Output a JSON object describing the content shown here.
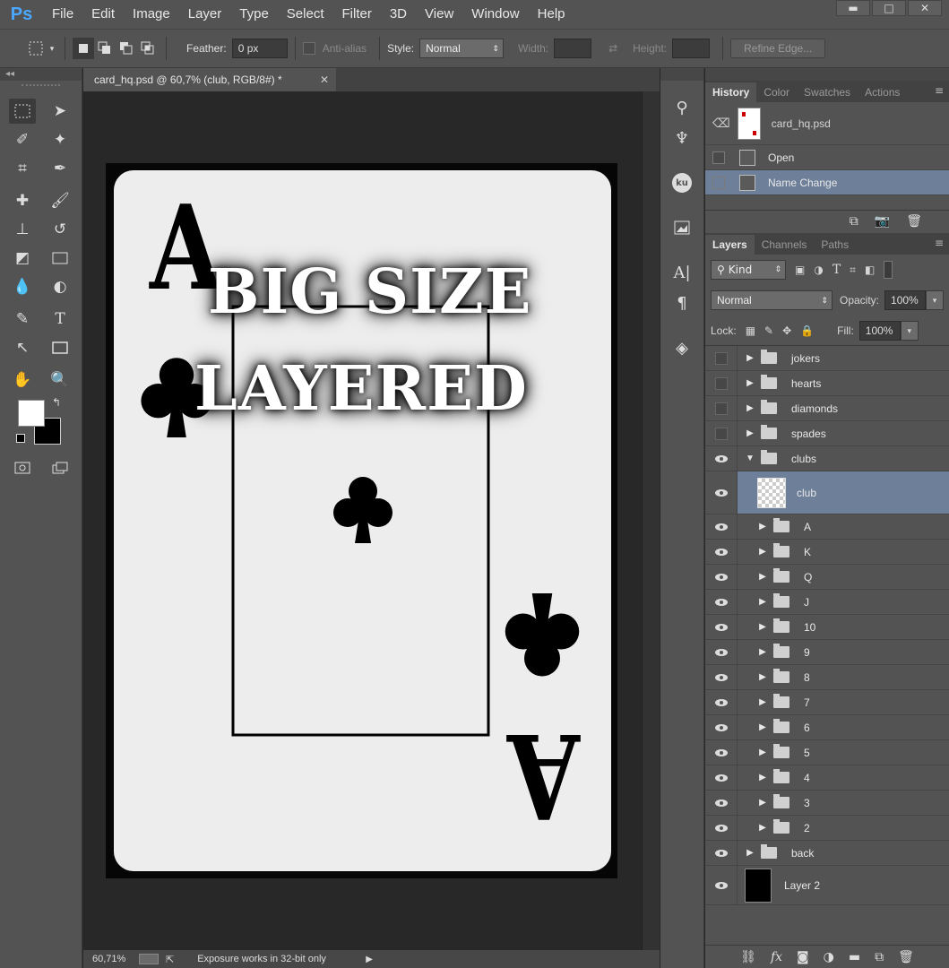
{
  "menubar": {
    "logo": "Ps",
    "items": [
      "File",
      "Edit",
      "Image",
      "Layer",
      "Type",
      "Select",
      "Filter",
      "3D",
      "View",
      "Window",
      "Help"
    ],
    "win_min": "▬",
    "win_max": "□",
    "win_close": "✕"
  },
  "options": {
    "feather_label": "Feather:",
    "feather_value": "0 px",
    "antialias_label": "Anti-alias",
    "style_label": "Style:",
    "style_value": "Normal",
    "width_label": "Width:",
    "height_label": "Height:",
    "refine_edge": "Refine Edge..."
  },
  "document": {
    "tab_title": "card_hq.psd @ 60,7% (club, RGB/8#) *",
    "close": "✕",
    "card": {
      "rank": "A",
      "overlay_line1": "BIG SIZE",
      "overlay_line2": "LAYERED"
    }
  },
  "statusbar": {
    "zoom": "60,71%",
    "info": "Exposure works in 32-bit only",
    "arrow": "▶"
  },
  "history": {
    "tabs": [
      "History",
      "Color",
      "Swatches",
      "Actions"
    ],
    "snapshot_name": "card_hq.psd",
    "steps": [
      {
        "label": "Open",
        "selected": false
      },
      {
        "label": "Name Change",
        "selected": true
      }
    ]
  },
  "layers": {
    "tabs": [
      "Layers",
      "Channels",
      "Paths"
    ],
    "filter_kind": "Kind",
    "blend_mode": "Normal",
    "opacity_label": "Opacity:",
    "opacity_value": "100%",
    "lock_label": "Lock:",
    "fill_label": "Fill:",
    "fill_value": "100%",
    "list": [
      {
        "name": "jokers",
        "type": "group",
        "visible": false,
        "indent": 0,
        "expanded": false
      },
      {
        "name": "hearts",
        "type": "group",
        "visible": false,
        "indent": 0,
        "expanded": false
      },
      {
        "name": "diamonds",
        "type": "group",
        "visible": false,
        "indent": 0,
        "expanded": false
      },
      {
        "name": "spades",
        "type": "group",
        "visible": false,
        "indent": 0,
        "expanded": false
      },
      {
        "name": "clubs",
        "type": "group",
        "visible": true,
        "indent": 0,
        "expanded": true
      },
      {
        "name": "club",
        "type": "layer-selected",
        "visible": true,
        "indent": 1
      },
      {
        "name": "A",
        "type": "group",
        "visible": true,
        "indent": 1,
        "expanded": false
      },
      {
        "name": "K",
        "type": "group",
        "visible": true,
        "indent": 1,
        "expanded": false
      },
      {
        "name": "Q",
        "type": "group",
        "visible": true,
        "indent": 1,
        "expanded": false
      },
      {
        "name": "J",
        "type": "group",
        "visible": true,
        "indent": 1,
        "expanded": false
      },
      {
        "name": "10",
        "type": "group",
        "visible": true,
        "indent": 1,
        "expanded": false
      },
      {
        "name": "9",
        "type": "group",
        "visible": true,
        "indent": 1,
        "expanded": false
      },
      {
        "name": "8",
        "type": "group",
        "visible": true,
        "indent": 1,
        "expanded": false
      },
      {
        "name": "7",
        "type": "group",
        "visible": true,
        "indent": 1,
        "expanded": false
      },
      {
        "name": "6",
        "type": "group",
        "visible": true,
        "indent": 1,
        "expanded": false
      },
      {
        "name": "5",
        "type": "group",
        "visible": true,
        "indent": 1,
        "expanded": false
      },
      {
        "name": "4",
        "type": "group",
        "visible": true,
        "indent": 1,
        "expanded": false
      },
      {
        "name": "3",
        "type": "group",
        "visible": true,
        "indent": 1,
        "expanded": false
      },
      {
        "name": "2",
        "type": "group",
        "visible": true,
        "indent": 1,
        "expanded": false
      },
      {
        "name": "back",
        "type": "group",
        "visible": true,
        "indent": 0,
        "expanded": false
      },
      {
        "name": "Layer 2",
        "type": "layer-black",
        "visible": true,
        "indent": 0
      }
    ]
  },
  "icons": {
    "eye": "👁",
    "fx": "fx"
  }
}
